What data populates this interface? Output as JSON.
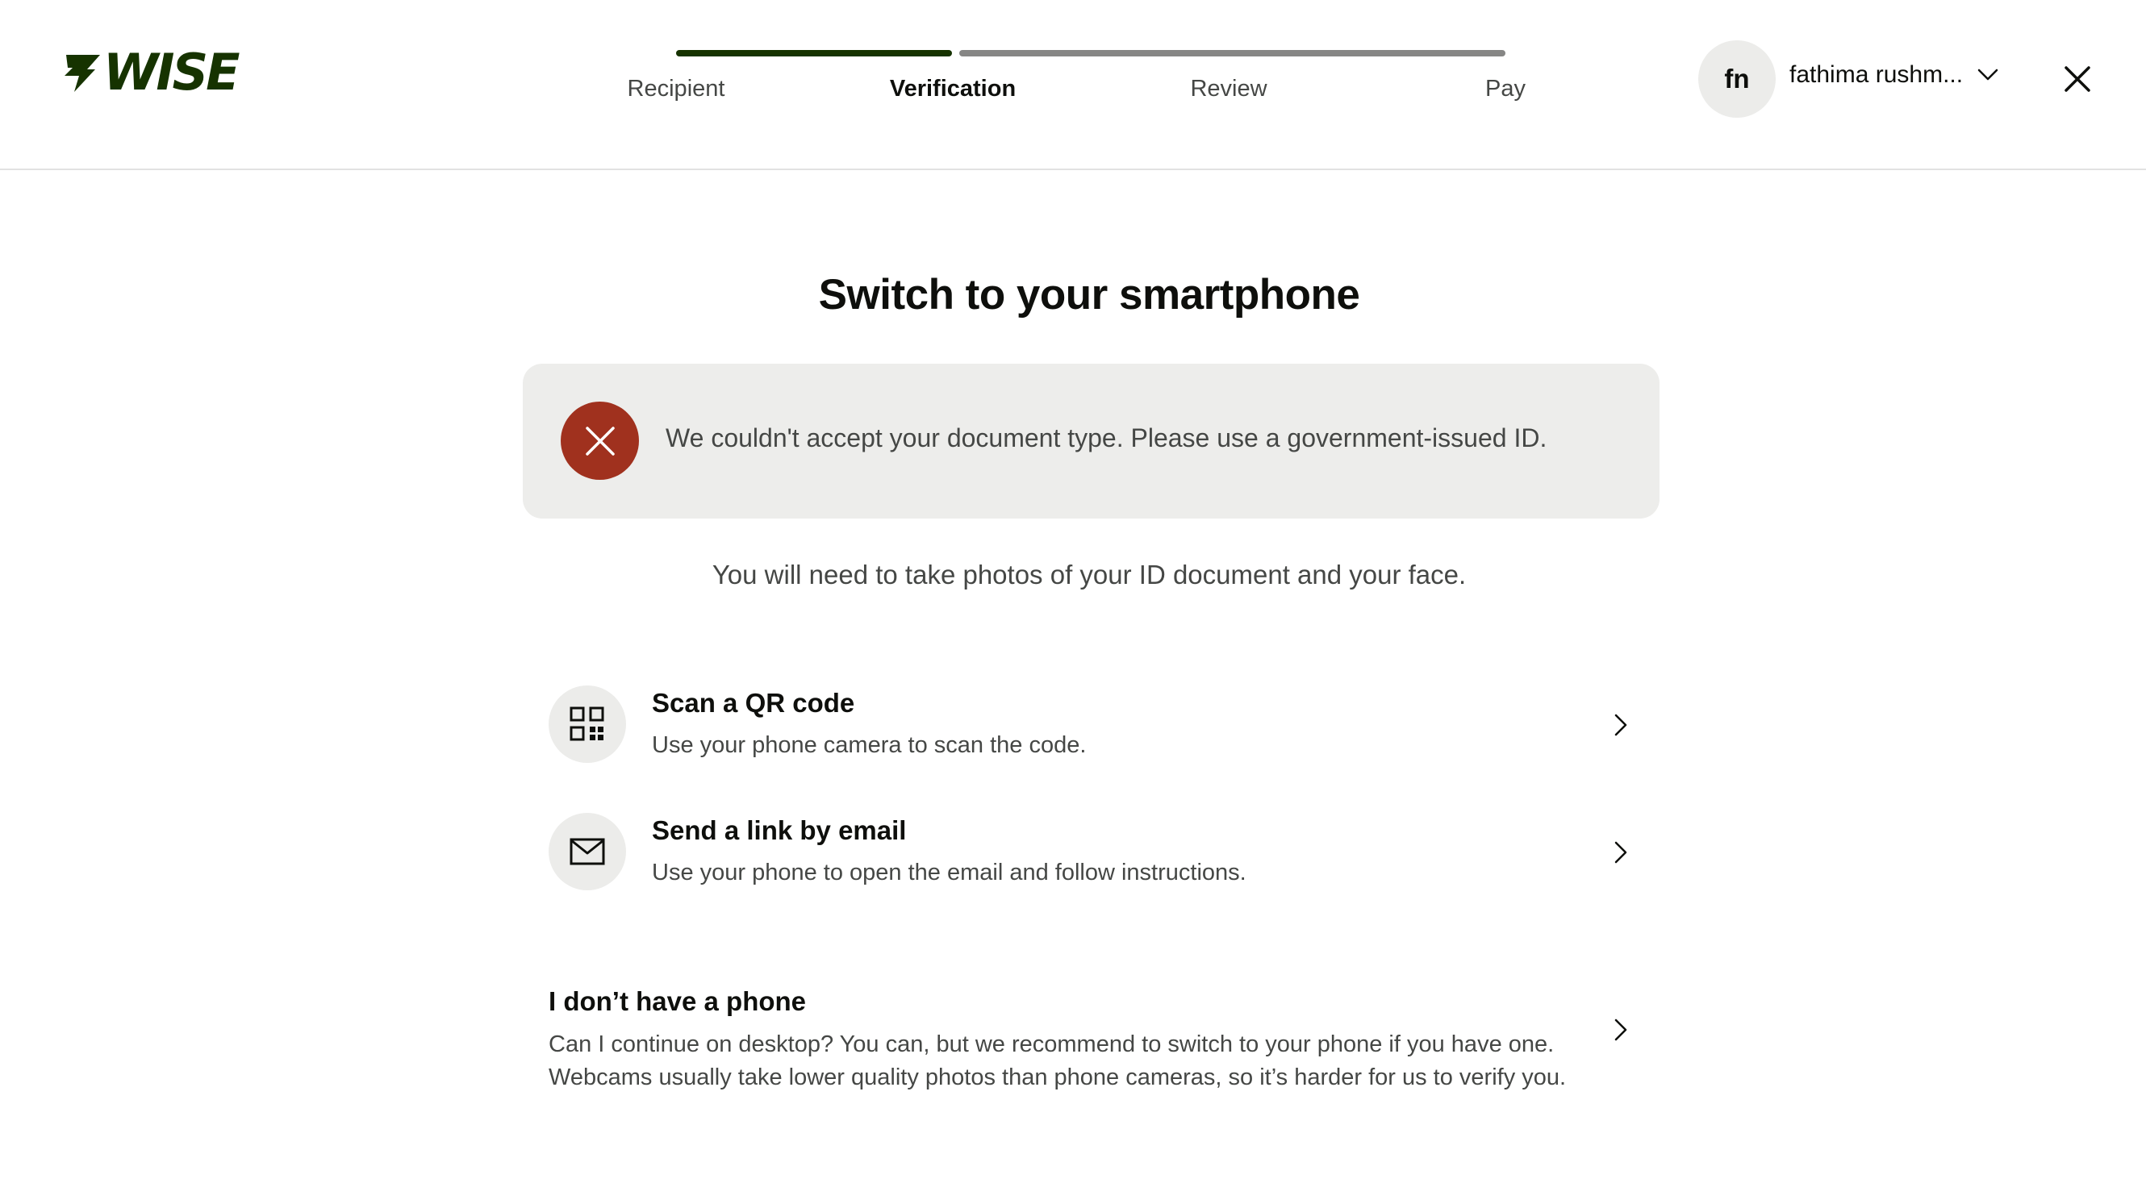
{
  "header": {
    "logo_text": "WISE",
    "steps": [
      {
        "label": "Recipient",
        "state": "done"
      },
      {
        "label": "Verification",
        "state": "active"
      },
      {
        "label": "Review",
        "state": "todo"
      },
      {
        "label": "Pay",
        "state": "todo"
      }
    ],
    "progress_fraction": 0.33,
    "user": {
      "initials": "fn",
      "name": "fathima rushm..."
    }
  },
  "main": {
    "title": "Switch to your smartphone",
    "alert": {
      "message": "We couldn't accept your document type. Please use a government-issued ID.",
      "icon": "error-x-icon",
      "color": "#a0311e"
    },
    "instruction": "You will need to take photos of your ID document and your face.",
    "options": [
      {
        "title": "Scan a QR code",
        "description": "Use your phone camera to scan the code.",
        "icon": "qr-code-icon"
      },
      {
        "title": "Send a link by email",
        "description": "Use your phone to open the email and follow instructions.",
        "icon": "envelope-icon"
      }
    ],
    "no_phone": {
      "title": "I don’t have a phone",
      "description": "Can I continue on desktop? You can, but we recommend to switch to your phone if you have one. Webcams usually take lower quality photos than phone cameras, so it’s harder for us to verify you."
    }
  },
  "colors": {
    "brand": "#163300",
    "alert_red": "#a0311e",
    "surface": "#ededeb",
    "text_secondary": "#454745"
  }
}
